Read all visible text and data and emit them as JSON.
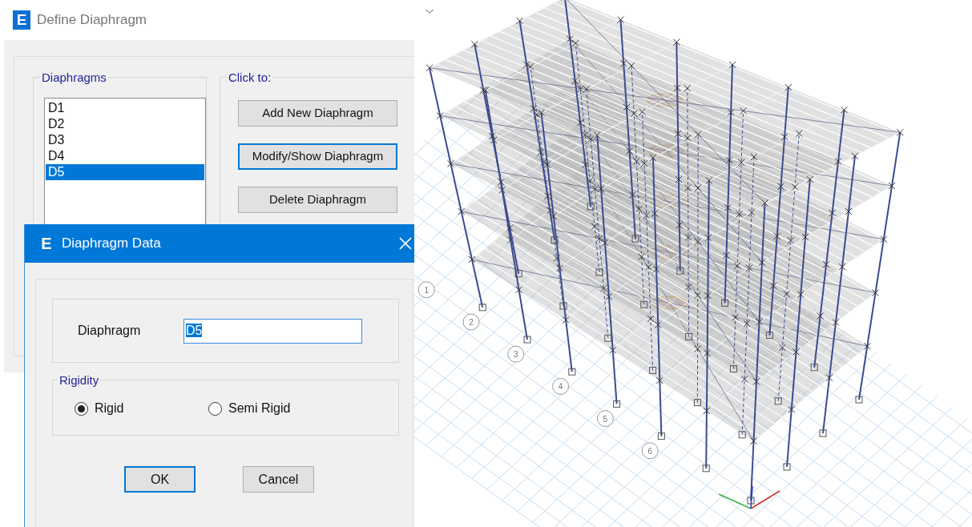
{
  "define_window": {
    "app_icon": "E",
    "title": "Define Diaphragm",
    "diaphragms_group": {
      "label": "Diaphragms",
      "items": [
        {
          "label": "D1",
          "selected": false
        },
        {
          "label": "D2",
          "selected": false
        },
        {
          "label": "D3",
          "selected": false
        },
        {
          "label": "D4",
          "selected": false
        },
        {
          "label": "D5",
          "selected": true
        }
      ]
    },
    "actions_group": {
      "label": "Click to:",
      "buttons": [
        {
          "label": "Add New Diaphragm",
          "focused": false
        },
        {
          "label": "Modify/Show Diaphragm",
          "focused": true
        },
        {
          "label": "Delete Diaphragm",
          "focused": false
        }
      ]
    }
  },
  "data_dialog": {
    "app_icon": "E",
    "title": "Diaphragm Data",
    "field": {
      "label": "Diaphragm",
      "value": "D5",
      "text_selected": true
    },
    "rigidity_group": {
      "label": "Rigidity",
      "options": [
        {
          "label": "Rigid",
          "selected": true
        },
        {
          "label": "Semi Rigid",
          "selected": false
        }
      ]
    },
    "buttons": [
      {
        "label": "OK",
        "default": true
      },
      {
        "label": "Cancel",
        "default": false
      }
    ]
  },
  "model_view": {
    "grid_labels": [
      "1",
      "2",
      "3",
      "4",
      "5",
      "6"
    ]
  }
}
